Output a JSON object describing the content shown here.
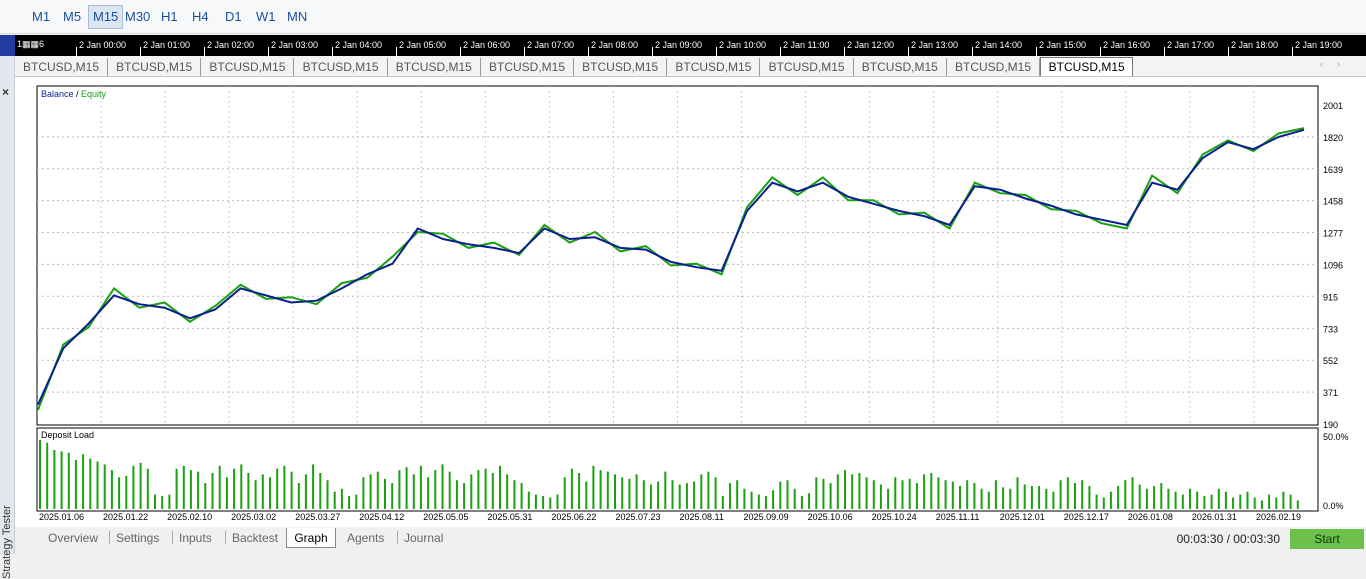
{
  "timeframes": [
    "M1",
    "M5",
    "M15",
    "M30",
    "H1",
    "H4",
    "D1",
    "W1",
    "MN"
  ],
  "active_timeframe": "M15",
  "time_strip": {
    "first_label": "1▦▦6",
    "labels": [
      "2 Jan 00:00",
      "2 Jan 01:00",
      "2 Jan 02:00",
      "2 Jan 03:00",
      "2 Jan 04:00",
      "2 Jan 05:00",
      "2 Jan 06:00",
      "2 Jan 07:00",
      "2 Jan 08:00",
      "2 Jan 09:00",
      "2 Jan 10:00",
      "2 Jan 11:00",
      "2 Jan 12:00",
      "2 Jan 13:00",
      "2 Jan 14:00",
      "2 Jan 15:00",
      "2 Jan 16:00",
      "2 Jan 17:00",
      "2 Jan 18:00",
      "2 Jan 19:00"
    ]
  },
  "chart_tabs": [
    "BTCUSD,M15",
    "BTCUSD,M15",
    "BTCUSD,M15",
    "BTCUSD,M15",
    "BTCUSD,M15",
    "BTCUSD,M15",
    "BTCUSD,M15",
    "BTCUSD,M15",
    "BTCUSD,M15",
    "BTCUSD,M15",
    "BTCUSD,M15",
    "BTCUSD,M15"
  ],
  "active_chart_tab": 11,
  "sidebar": {
    "close": "×",
    "label": "Strategy Tester"
  },
  "chart_data": [
    {
      "type": "line",
      "legend": {
        "balance": "Balance",
        "separator": " / ",
        "equity": "Equity"
      },
      "colors": {
        "balance": "#0a1f8f",
        "equity": "#1aa012"
      },
      "ylim": [
        190,
        2001
      ],
      "y_ticks": [
        "2001",
        "1820",
        "1639",
        "1458",
        "1277",
        "1096",
        "915",
        "733",
        "552",
        "371",
        "190"
      ],
      "grid": true,
      "x": [
        0,
        2,
        4,
        6,
        8,
        10,
        12,
        14,
        16,
        18,
        20,
        22,
        24,
        26,
        28,
        30,
        32,
        34,
        36,
        38,
        40,
        42,
        44,
        46,
        48,
        50,
        52,
        54,
        56,
        58,
        60,
        62,
        64,
        66,
        68,
        70,
        72,
        74,
        76,
        78,
        80,
        82,
        84,
        86,
        88,
        90,
        92,
        94,
        96,
        98,
        100
      ],
      "series": [
        {
          "name": "Balance",
          "values": [
            300,
            620,
            760,
            920,
            870,
            850,
            790,
            840,
            960,
            920,
            880,
            890,
            960,
            1040,
            1100,
            1300,
            1240,
            1210,
            1190,
            1160,
            1300,
            1240,
            1250,
            1190,
            1180,
            1110,
            1080,
            1060,
            1400,
            1560,
            1510,
            1560,
            1480,
            1440,
            1400,
            1370,
            1320,
            1540,
            1520,
            1470,
            1430,
            1380,
            1350,
            1320,
            1560,
            1520,
            1700,
            1790,
            1750,
            1820,
            1860
          ]
        },
        {
          "name": "Equity",
          "values": [
            270,
            640,
            740,
            960,
            850,
            880,
            770,
            860,
            980,
            900,
            910,
            870,
            990,
            1020,
            1140,
            1280,
            1270,
            1190,
            1220,
            1150,
            1320,
            1220,
            1280,
            1170,
            1200,
            1090,
            1100,
            1040,
            1420,
            1590,
            1490,
            1590,
            1460,
            1460,
            1380,
            1390,
            1300,
            1560,
            1500,
            1490,
            1410,
            1400,
            1330,
            1300,
            1600,
            1500,
            1720,
            1800,
            1740,
            1840,
            1870
          ]
        }
      ]
    },
    {
      "type": "bar",
      "title": "Deposit Load",
      "color": "#1aa012",
      "ylim": [
        0,
        50
      ],
      "y_ticks": [
        "50.0%",
        "0.0%"
      ],
      "x_tick_labels": [
        "2025.01.06",
        "2025.01.22",
        "2025.02.10",
        "2025.03.02",
        "2025.03.27",
        "2025.04.12",
        "2025.05.05",
        "2025.05.31",
        "2025.06.22",
        "2025.07.23",
        "2025.08.11",
        "2025.09.09",
        "2025.10.06",
        "2025.10.24",
        "2025.11.11",
        "2025.12.01",
        "2025.12.17",
        "2026.01.08",
        "2026.01.31",
        "2026.02.19"
      ],
      "values": [
        48,
        46,
        41,
        40,
        39,
        34,
        38,
        35,
        33,
        31,
        27,
        22,
        23,
        30,
        32,
        28,
        10,
        9,
        10,
        28,
        30,
        27,
        26,
        18,
        25,
        30,
        22,
        28,
        31,
        25,
        20,
        24,
        22,
        28,
        30,
        26,
        18,
        24,
        31,
        25,
        20,
        12,
        14,
        9,
        10,
        22,
        24,
        26,
        21,
        18,
        27,
        29,
        24,
        30,
        22,
        27,
        31,
        26,
        20,
        18,
        24,
        27,
        28,
        25,
        30,
        24,
        20,
        18,
        12,
        10,
        9,
        8,
        10,
        22,
        28,
        25,
        19,
        30,
        27,
        26,
        24,
        22,
        21,
        24,
        20,
        17,
        19,
        26,
        20,
        17,
        18,
        19,
        24,
        26,
        22,
        9,
        18,
        20,
        14,
        12,
        10,
        9,
        13,
        19,
        20,
        14,
        9,
        11,
        22,
        21,
        18,
        24,
        27,
        24,
        25,
        22,
        20,
        17,
        14,
        22,
        20,
        21,
        18,
        24,
        25,
        22,
        20,
        19,
        16,
        20,
        18,
        14,
        12,
        20,
        15,
        14,
        22,
        17,
        16,
        16,
        14,
        12,
        20,
        22,
        18,
        20,
        16,
        10,
        8,
        12,
        16,
        20,
        22,
        17,
        14,
        16,
        18,
        14,
        12,
        10,
        14,
        12,
        9,
        10,
        14,
        12,
        8,
        10,
        12,
        8,
        6,
        10,
        8,
        12,
        10,
        6
      ]
    }
  ],
  "bottom_tabs": [
    "Overview",
    "Settings",
    "Inputs",
    "Backtest",
    "Graph",
    "Agents",
    "Journal"
  ],
  "active_bottom_tab": "Graph",
  "timer": "00:03:30 / 00:03:30",
  "start_label": "Start"
}
